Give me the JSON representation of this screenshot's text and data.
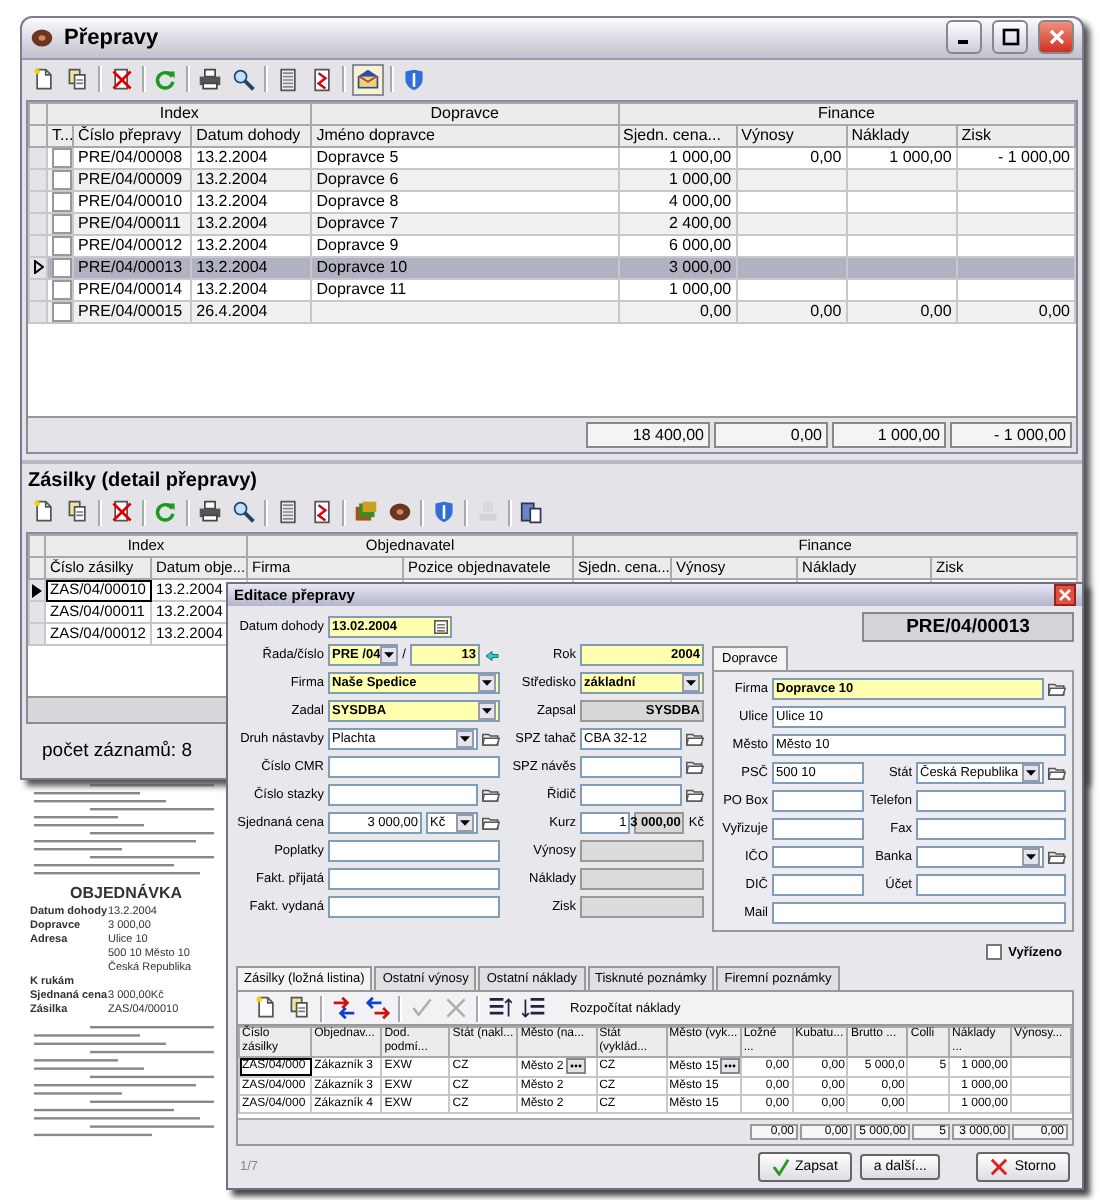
{
  "main_window": {
    "title": "Přepravy",
    "toolbar": [
      {
        "kind": "new",
        "divider": false,
        "pressed": false
      },
      {
        "kind": "copy",
        "divider": false,
        "pressed": false
      },
      {
        "kind": "delete",
        "divider": true,
        "pressed": false
      },
      {
        "kind": "refresh",
        "divider": true,
        "pressed": false
      },
      {
        "kind": "print",
        "divider": true,
        "pressed": false
      },
      {
        "kind": "search",
        "divider": false,
        "pressed": false
      },
      {
        "kind": "sheet",
        "divider": true,
        "pressed": false
      },
      {
        "kind": "report",
        "divider": false,
        "pressed": false
      },
      {
        "kind": "mail",
        "divider": true,
        "pressed": true
      },
      {
        "kind": "shield",
        "divider": true,
        "pressed": false
      }
    ],
    "grid": {
      "groups": [
        "Index",
        "Dopravce",
        "Finance"
      ],
      "check_header": "T...",
      "columns": [
        "Číslo přepravy",
        "Datum dohody",
        "Jméno dopravce",
        "Sjedn. cena...",
        "Výnosy",
        "Náklady",
        "Zisk"
      ],
      "rows": [
        {
          "selected": false,
          "checked": false,
          "cells": [
            "PRE/04/00008",
            "13.2.2004",
            "Dopravce 5",
            "1 000,00",
            "0,00",
            "1 000,00",
            "- 1 000,00"
          ]
        },
        {
          "selected": false,
          "checked": false,
          "cells": [
            "PRE/04/00009",
            "13.2.2004",
            "Dopravce 6",
            "1 000,00",
            "",
            "",
            ""
          ]
        },
        {
          "selected": false,
          "checked": false,
          "cells": [
            "PRE/04/00010",
            "13.2.2004",
            "Dopravce 8",
            "4 000,00",
            "",
            "",
            ""
          ]
        },
        {
          "selected": false,
          "checked": false,
          "cells": [
            "PRE/04/00011",
            "13.2.2004",
            "Dopravce 7",
            "2 400,00",
            "",
            "",
            ""
          ]
        },
        {
          "selected": false,
          "checked": false,
          "cells": [
            "PRE/04/00012",
            "13.2.2004",
            "Dopravce 9",
            "6 000,00",
            "",
            "",
            ""
          ]
        },
        {
          "selected": true,
          "checked": false,
          "cells": [
            "PRE/04/00013",
            "13.2.2004",
            "Dopravce 10",
            "3 000,00",
            "",
            "",
            ""
          ]
        },
        {
          "selected": false,
          "checked": false,
          "cells": [
            "PRE/04/00014",
            "13.2.2004",
            "Dopravce 11",
            "1 000,00",
            "",
            "",
            ""
          ]
        },
        {
          "selected": false,
          "checked": false,
          "cells": [
            "PRE/04/00015",
            "26.4.2004",
            "",
            "0,00",
            "0,00",
            "0,00",
            "0,00"
          ]
        }
      ],
      "totals": [
        "18 400,00",
        "0,00",
        "1 000,00",
        "- 1 000,00"
      ]
    },
    "detail": {
      "title": "Zásilky (detail přepravy)",
      "toolbar": [
        {
          "kind": "new",
          "divider": false,
          "disabled": false
        },
        {
          "kind": "copy",
          "divider": false,
          "disabled": false
        },
        {
          "kind": "delete",
          "divider": true,
          "disabled": false
        },
        {
          "kind": "refresh",
          "divider": true,
          "disabled": false
        },
        {
          "kind": "print",
          "divider": true,
          "disabled": false
        },
        {
          "kind": "search",
          "divider": false,
          "disabled": false
        },
        {
          "kind": "sheet",
          "divider": true,
          "disabled": false
        },
        {
          "kind": "report",
          "divider": false,
          "disabled": false
        },
        {
          "kind": "books",
          "divider": true,
          "disabled": false
        },
        {
          "kind": "disc",
          "divider": false,
          "disabled": false
        },
        {
          "kind": "shield",
          "divider": true,
          "disabled": false
        },
        {
          "kind": "stamp",
          "divider": true,
          "disabled": true
        },
        {
          "kind": "paste",
          "divider": true,
          "disabled": false
        }
      ],
      "grid": {
        "groups": [
          "Index",
          "Objednavatel",
          "Finance"
        ],
        "columns": [
          "Číslo zásilky",
          "Datum obje...",
          "Firma",
          "Pozice objednavatele",
          "Sjedn. cena...",
          "Výnosy",
          "Náklady",
          "Zisk"
        ],
        "rows": [
          {
            "selected": true,
            "cells": [
              "ZAS/04/00010",
              "13.2.2004"
            ]
          },
          {
            "selected": false,
            "cells": [
              "ZAS/04/00011",
              "13.2.2004"
            ]
          },
          {
            "selected": false,
            "cells": [
              "ZAS/04/00012",
              "13.2.2004"
            ]
          }
        ]
      },
      "status": "počet záznamů: 8"
    }
  },
  "document": {
    "heading": "OBJEDNÁVKA",
    "lines": [
      {
        "label": "Datum dohody",
        "value": "13.2.2004"
      },
      {
        "label": "Dopravce",
        "value": "3 000,00"
      },
      {
        "label": "Adresa",
        "value": "Ulice 10"
      },
      {
        "value": "500 10 Město 10"
      },
      {
        "value": "Česká Republika"
      },
      {
        "label": "K rukám"
      },
      {
        "label": "Sjednaná cena",
        "value": "3 000,00Kč"
      },
      {
        "label": "Zásilka",
        "value": "ZAS/04/00010"
      }
    ]
  },
  "dialog": {
    "title": "Editace přepravy",
    "form_rows": [
      {
        "left": [
          {
            "kind": "date",
            "label": "Datum dohody",
            "value": "13.02.2004",
            "required": true
          }
        ],
        "right": []
      },
      {
        "left": [
          {
            "kind": "combo",
            "label": "Řada/číslo",
            "value": "PRE /04",
            "required": true
          },
          {
            "kind": "separator",
            "value": "/"
          },
          {
            "kind": "number",
            "value": "13",
            "required": true,
            "jump": true
          }
        ],
        "right": [
          {
            "kind": "number",
            "label": "Rok",
            "value": "2004",
            "required": true
          }
        ]
      },
      {
        "left": [
          {
            "kind": "combo",
            "label": "Firma",
            "value": "Naše Spedice",
            "required": true
          }
        ],
        "right": [
          {
            "kind": "combo",
            "label": "Středisko",
            "value": "základní",
            "required": true
          }
        ]
      },
      {
        "left": [
          {
            "kind": "combo",
            "label": "Zadal",
            "value": "SYSDBA",
            "required": true
          }
        ],
        "right": [
          {
            "kind": "readonly",
            "label": "Zapsal",
            "value": "SYSDBA"
          }
        ]
      },
      {
        "left": [
          {
            "kind": "combo",
            "label": "Druh nástavby",
            "value": "Plachta",
            "browse": true
          }
        ],
        "right": [
          {
            "kind": "text",
            "label": "SPZ tahač",
            "value": "CBA 32-12",
            "browse": true
          }
        ]
      },
      {
        "left": [
          {
            "kind": "text",
            "label": "Číslo CMR"
          }
        ],
        "right": [
          {
            "kind": "text",
            "label": "SPZ návěs",
            "browse": true
          }
        ]
      },
      {
        "left": [
          {
            "kind": "text",
            "label": "Číslo stazky",
            "browse": true
          }
        ],
        "right": [
          {
            "kind": "text",
            "label": "Řidič",
            "browse": true
          }
        ]
      },
      {
        "left": [
          {
            "kind": "number",
            "label": "Sjednaná cena",
            "value": "3 000,00"
          },
          {
            "kind": "unit",
            "value": "Kč",
            "browse": true
          }
        ],
        "right": [
          {
            "kind": "number",
            "label": "Kurz",
            "value": "1"
          },
          {
            "kind": "readonly",
            "value": "3 000,00",
            "suffix": "Kč"
          }
        ]
      },
      {
        "left": [
          {
            "kind": "text",
            "label": "Poplatky"
          }
        ],
        "right": [
          {
            "kind": "disabled",
            "label": "Výnosy"
          }
        ]
      },
      {
        "left": [
          {
            "kind": "text",
            "label": "Fakt. přijatá"
          }
        ],
        "right": [
          {
            "kind": "disabled",
            "label": "Náklady"
          }
        ]
      },
      {
        "left": [
          {
            "kind": "text",
            "label": "Fakt. vydaná"
          }
        ],
        "right": [
          {
            "kind": "disabled",
            "label": "Zisk"
          }
        ]
      }
    ],
    "number_badge": "PRE/04/00013",
    "side_tab": "Dopravce",
    "carrier_rows": [
      [
        {
          "kind": "text",
          "label": "Firma",
          "value": "Dopravce 10",
          "required": true,
          "browse": true
        }
      ],
      [
        {
          "kind": "text",
          "label": "Ulice",
          "value": "Ulice 10"
        }
      ],
      [
        {
          "kind": "text",
          "label": "Město",
          "value": "Město 10"
        }
      ],
      [
        {
          "kind": "text",
          "label": "PSČ",
          "value": "500 10"
        },
        {
          "kind": "combo",
          "label": "Stát",
          "value": "Česká Republika",
          "browse": true
        }
      ],
      [
        {
          "kind": "text",
          "label": "PO Box"
        },
        {
          "kind": "text",
          "label": "Telefon"
        }
      ],
      [
        {
          "kind": "text",
          "label": "Vyřizuje"
        },
        {
          "kind": "text",
          "label": "Fax"
        }
      ],
      [
        {
          "kind": "text",
          "label": "IČO"
        },
        {
          "kind": "combo",
          "label": "Banka",
          "browse": true
        }
      ],
      [
        {
          "kind": "text",
          "label": "DIČ"
        },
        {
          "kind": "text",
          "label": "Účet"
        }
      ],
      [
        {
          "kind": "text",
          "label": "Mail"
        }
      ]
    ],
    "done": {
      "label": "Vyřízeno",
      "checked": false
    },
    "tabs": [
      {
        "label": "Zásilky (ložná listina)",
        "selected": true
      },
      {
        "label": "Ostatní výnosy",
        "selected": false
      },
      {
        "label": "Ostatní náklady",
        "selected": false
      },
      {
        "label": "Tisknuté poznámky",
        "selected": false
      },
      {
        "label": "Firemní poznámky",
        "selected": false
      }
    ],
    "toolbar": [
      {
        "kind": "new",
        "divider": false,
        "disabled": false
      },
      {
        "kind": "copy",
        "divider": false,
        "disabled": false
      },
      {
        "kind": "arrows-in",
        "divider": true,
        "disabled": false
      },
      {
        "kind": "arrows-out",
        "divider": false,
        "disabled": false
      },
      {
        "kind": "check",
        "divider": true,
        "disabled": true
      },
      {
        "kind": "cross",
        "divider": false,
        "disabled": true
      },
      {
        "kind": "row-up",
        "divider": true,
        "disabled": false
      },
      {
        "kind": "row-down",
        "divider": false,
        "disabled": false
      }
    ],
    "toolbar_action": "Rozpočítat náklady",
    "grid": {
      "columns": [
        "Číslo zásilky",
        "Objednav...",
        "Dod. podmí...",
        "Stát (nakl...",
        "Město (na...",
        "Stát (vyklád...",
        "Město (vyk...",
        "Ložné ...",
        "Kubatu...",
        "Brutto ...",
        "Colli",
        "Náklady ...",
        "Výnosy..."
      ],
      "rows": [
        {
          "selected": true,
          "pickers": true,
          "cells": [
            "ZAS/04/000",
            "Zákazník 3",
            "EXW",
            "CZ",
            "Město 2",
            "CZ",
            "Město 15",
            "0,00",
            "0,00",
            "5 000,0",
            "5",
            "1 000,00",
            ""
          ]
        },
        {
          "selected": false,
          "pickers": false,
          "cells": [
            "ZAS/04/000",
            "Zákazník 3",
            "EXW",
            "CZ",
            "Město 2",
            "CZ",
            "Město 15",
            "0,00",
            "0,00",
            "0,00",
            "",
            "1 000,00",
            ""
          ]
        },
        {
          "selected": false,
          "pickers": false,
          "cells": [
            "ZAS/04/000",
            "Zákazník 4",
            "EXW",
            "CZ",
            "Město 2",
            "CZ",
            "Město 15",
            "0,00",
            "0,00",
            "0,00",
            "",
            "1 000,00",
            ""
          ]
        }
      ],
      "totals": [
        "0,00",
        "0,00",
        "5 000,00",
        "5",
        "3 000,00",
        "0,00"
      ]
    },
    "status": "1/7",
    "buttons": [
      {
        "kind": "save",
        "label": "Zapsat"
      },
      {
        "kind": "plain",
        "label": "a další..."
      },
      {
        "kind": "cancel",
        "label": "Storno"
      }
    ]
  }
}
